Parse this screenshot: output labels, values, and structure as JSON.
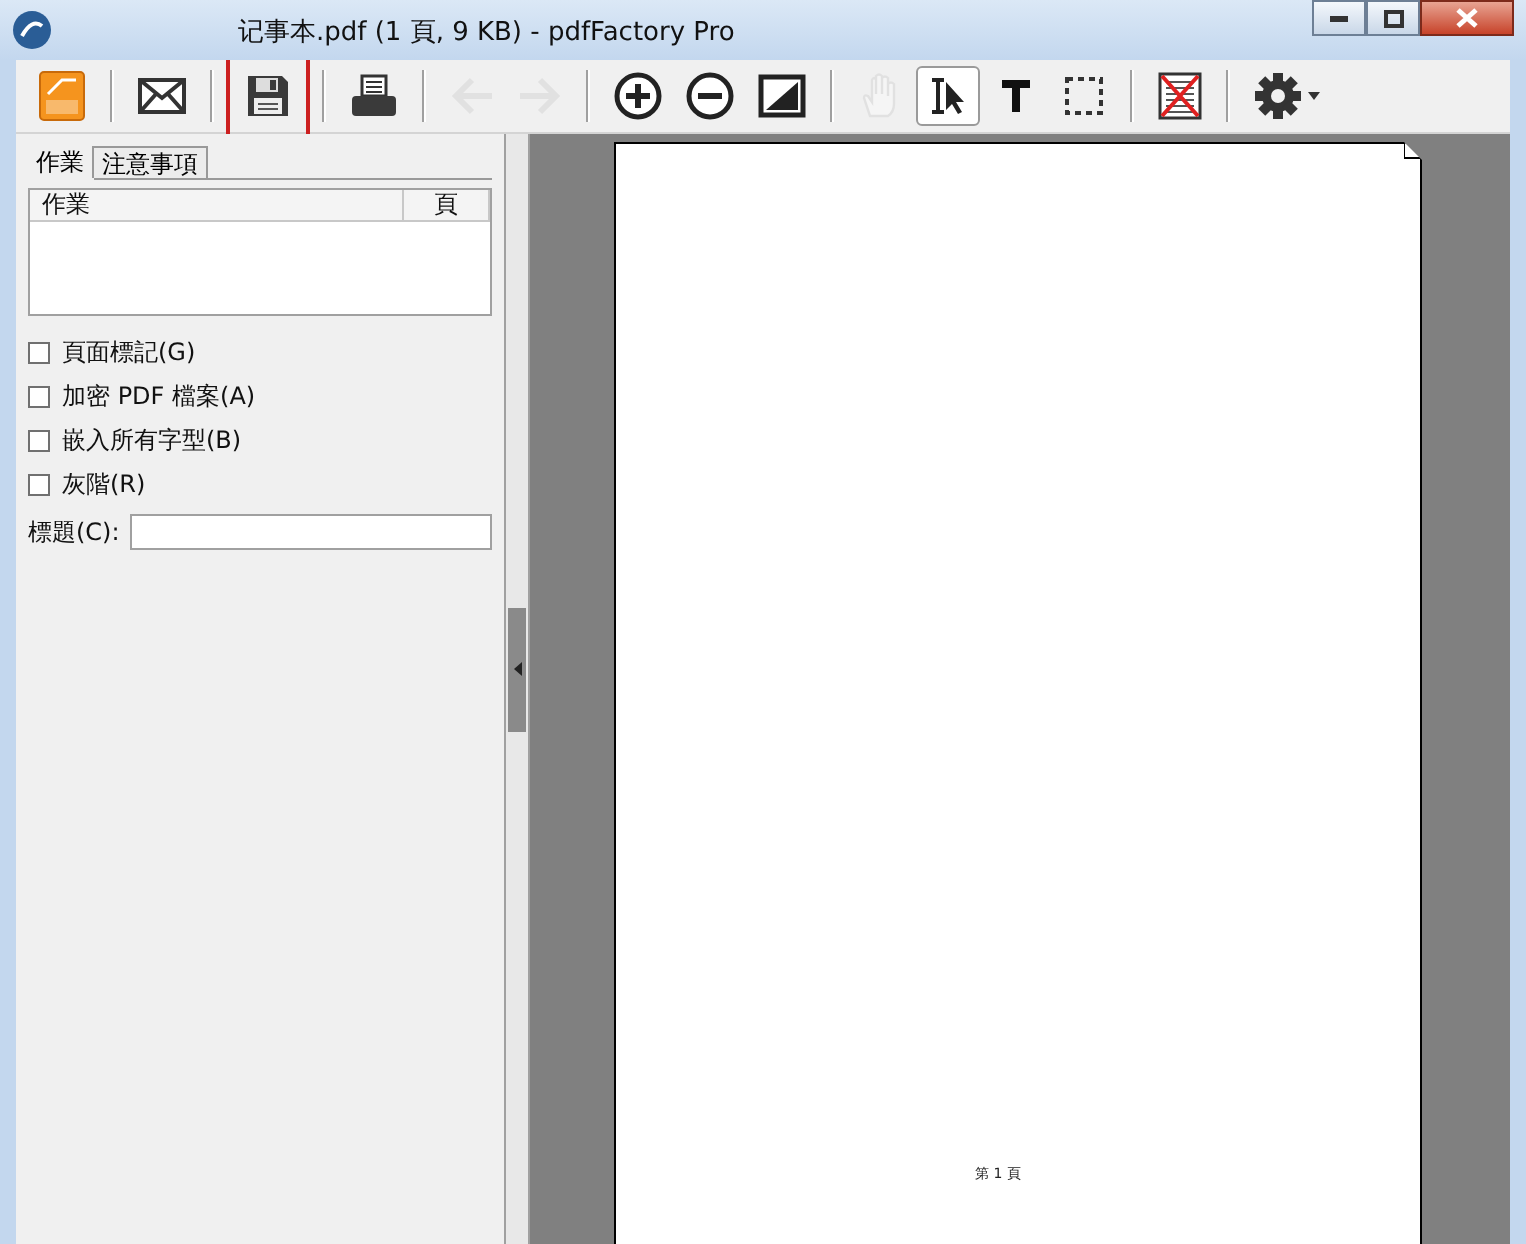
{
  "window": {
    "title": "记事本.pdf (1 頁, 9 KB) - pdfFactory Pro"
  },
  "toolbar": [
    {
      "kind": "pdf",
      "disabled": false,
      "selected": false,
      "highlighted": false
    },
    {
      "kind": "separator"
    },
    {
      "kind": "mail",
      "disabled": false,
      "selected": false,
      "highlighted": false
    },
    {
      "kind": "separator"
    },
    {
      "kind": "save",
      "disabled": false,
      "selected": false,
      "highlighted": true
    },
    {
      "kind": "separator"
    },
    {
      "kind": "print",
      "disabled": false,
      "selected": false,
      "highlighted": false
    },
    {
      "kind": "separator"
    },
    {
      "kind": "back",
      "disabled": true,
      "selected": false,
      "highlighted": false
    },
    {
      "kind": "forward",
      "disabled": true,
      "selected": false,
      "highlighted": false
    },
    {
      "kind": "separator"
    },
    {
      "kind": "zoom-in",
      "disabled": false,
      "selected": false,
      "highlighted": false
    },
    {
      "kind": "zoom-out",
      "disabled": false,
      "selected": false,
      "highlighted": false
    },
    {
      "kind": "fit",
      "disabled": false,
      "selected": false,
      "highlighted": false
    },
    {
      "kind": "separator"
    },
    {
      "kind": "hand",
      "disabled": true,
      "selected": false,
      "highlighted": false
    },
    {
      "kind": "select",
      "disabled": false,
      "selected": true,
      "highlighted": false
    },
    {
      "kind": "text",
      "disabled": false,
      "selected": false,
      "highlighted": false
    },
    {
      "kind": "marquee",
      "disabled": false,
      "selected": false,
      "highlighted": false
    },
    {
      "kind": "separator"
    },
    {
      "kind": "delete",
      "disabled": false,
      "selected": false,
      "highlighted": false
    },
    {
      "kind": "separator"
    },
    {
      "kind": "settings",
      "disabled": false,
      "selected": false,
      "highlighted": false
    }
  ],
  "side_panel": {
    "tabs": [
      {
        "label": "作業",
        "selected": true
      },
      {
        "label": "注意事項",
        "selected": false
      }
    ],
    "job_list": {
      "columns": [
        "作業",
        "頁"
      ]
    },
    "options": [
      {
        "label": "頁面標記(G)",
        "checked": false
      },
      {
        "label": "加密 PDF 檔案(A)",
        "checked": false
      },
      {
        "label": "嵌入所有字型(B)",
        "checked": false
      },
      {
        "label": "灰階(R)",
        "checked": false
      }
    ],
    "title_field": {
      "label": "標題(C):"
    }
  },
  "preview": {
    "footer": "第 1 頁"
  }
}
